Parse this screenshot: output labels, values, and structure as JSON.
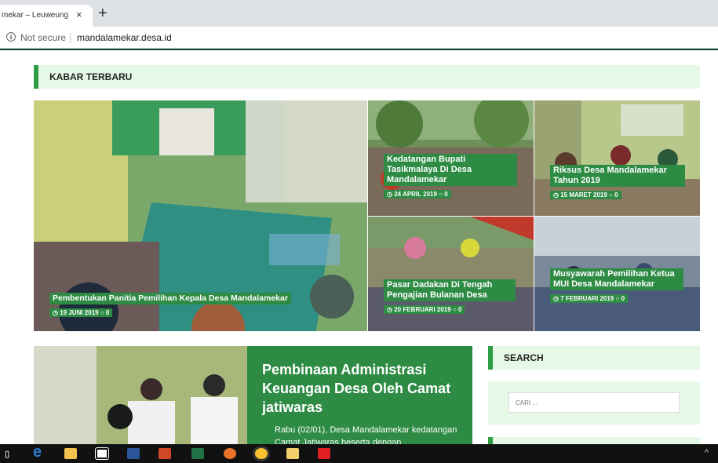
{
  "browser": {
    "tab_title": "mekar – Leuweung",
    "tab_close": "×",
    "new_tab": "+",
    "security_label": "Not secure",
    "url": "mandalamekar.desa.id"
  },
  "section": {
    "title": "KABAR TERBARU"
  },
  "featured": [
    {
      "title": "Pembentukan Panitia Pemilihan Kepala Desa Mandalamekar",
      "date": "19 JUNI 2019",
      "comments": "0"
    },
    {
      "title": "Kedatangan Bupati Tasikmalaya Di Desa Mandalamekar",
      "date": "24 APRIL 2019",
      "comments": "0"
    },
    {
      "title": "Riksus Desa Mandalamekar Tahun 2019",
      "date": "15 MARET 2019",
      "comments": "0"
    },
    {
      "title": "Pasar Dadakan Di Tengah Pengajian Bulanan Desa",
      "date": "20 FEBRUARI 2019",
      "comments": "0"
    },
    {
      "title": "Musyawarah Pemilihan Ketua MUI Desa Mandalamekar",
      "date": "7 FEBRUARI 2019",
      "comments": "0"
    }
  ],
  "post": {
    "title": "Pembinaan Administrasi Keuangan Desa Oleh Camat jatiwaras",
    "excerpt": "Rabu (02/01), Desa Mandalamekar kedatangan Camat Jatiwaras beserta dengan"
  },
  "sidebar": {
    "search_title": "SEARCH",
    "search_placeholder": "CARI ..."
  },
  "taskbar": {
    "items": [
      "task-view-icon",
      "edge-icon",
      "file-explorer-icon",
      "store-icon",
      "word-icon",
      "powerpoint-icon",
      "excel-icon",
      "firefox-icon",
      "chrome-icon",
      "folder-icon",
      "acrobat-icon"
    ],
    "tray": "^"
  },
  "colors": {
    "accent": "#2e8b44",
    "accent_light": "#e6f8e6"
  }
}
